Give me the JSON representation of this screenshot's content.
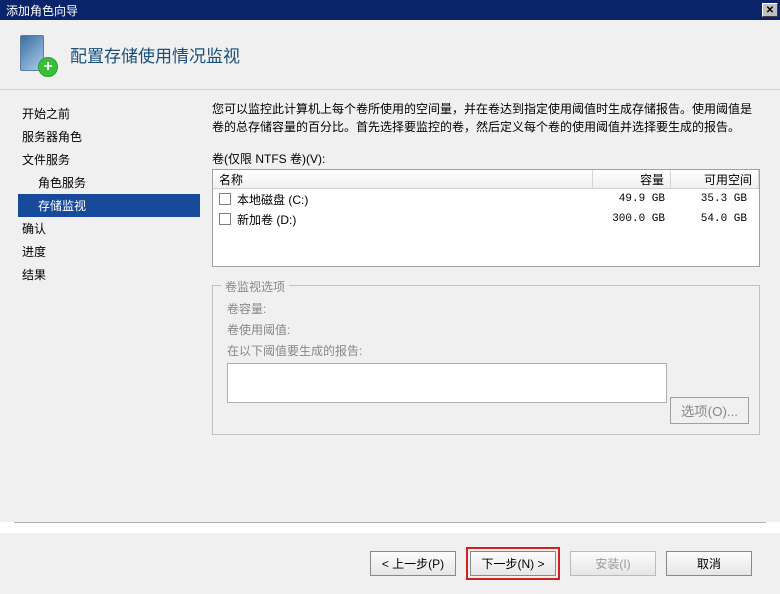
{
  "window": {
    "title": "添加角色向导"
  },
  "header": {
    "title": "配置存储使用情况监视"
  },
  "sidebar": {
    "items": [
      {
        "label": "开始之前",
        "indent": false
      },
      {
        "label": "服务器角色",
        "indent": false
      },
      {
        "label": "文件服务",
        "indent": false
      },
      {
        "label": "角色服务",
        "indent": true
      },
      {
        "label": "存储监视",
        "indent": true,
        "selected": true
      },
      {
        "label": "确认",
        "indent": false
      },
      {
        "label": "进度",
        "indent": false
      },
      {
        "label": "结果",
        "indent": false
      }
    ]
  },
  "main": {
    "description": "您可以监控此计算机上每个卷所使用的空间量，并在卷达到指定使用阈值时生成存储报告。使用阈值是卷的总存储容量的百分比。首先选择要监控的卷，然后定义每个卷的使用阈值并选择要生成的报告。",
    "volumes_label": "卷(仅限 NTFS 卷)(V):",
    "columns": {
      "name": "名称",
      "capacity": "容量",
      "free": "可用空间"
    },
    "volumes": [
      {
        "name": "本地磁盘 (C:)",
        "capacity": "49.9 GB",
        "free": "35.3 GB"
      },
      {
        "name": "新加卷 (D:)",
        "capacity": "300.0 GB",
        "free": "54.0 GB"
      }
    ],
    "group": {
      "title": "卷监视选项",
      "capacity_label": "卷容量:",
      "threshold_label": "卷使用阈值:",
      "reports_label": "在以下阈值要生成的报告:",
      "options_btn": "选项(O)..."
    }
  },
  "footer": {
    "back": "< 上一步(P)",
    "next": "下一步(N) >",
    "install": "安装(I)",
    "cancel": "取消"
  }
}
